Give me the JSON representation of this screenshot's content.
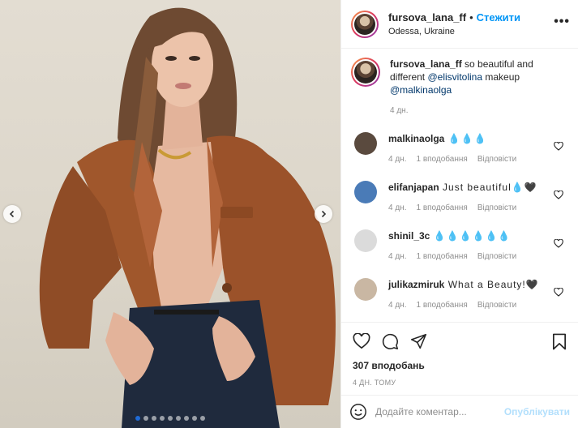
{
  "post": {
    "author": "fursova_lana_ff",
    "follow_label": "Стежити",
    "location": "Odessa, Ukraine",
    "more_label": "•••"
  },
  "caption": {
    "author": "fursova_lana_ff",
    "text_part1": " so beautiful and different ",
    "mention1": "@elisvitolina",
    "text_part2": " makeup ",
    "mention2": "@malkinaolga",
    "age": "4 дн."
  },
  "comments": [
    {
      "user": "malkinaolga",
      "text": " 💧💧💧",
      "age": "4 дн.",
      "likes": "1 вподобання",
      "reply": "Відповісти",
      "avatar_color": "#5a4a3e"
    },
    {
      "user": "elifanjapan",
      "text": " Just beautiful💧🖤",
      "age": "4 дн.",
      "likes": "1 вподобання",
      "reply": "Відповісти",
      "avatar_color": "#4a7bb7"
    },
    {
      "user": "shinil_3c",
      "text": " 💧💧💧💧💧💧",
      "age": "4 дн.",
      "likes": "1 вподобання",
      "reply": "Відповісти",
      "avatar_color": "#dbdbdb"
    },
    {
      "user": "julikazmiruk",
      "text": " What a Beauty!🖤",
      "age": "4 дн.",
      "likes": "1 вподобання",
      "reply": "Відповісти",
      "avatar_color": "#c9b7a3"
    }
  ],
  "stats": {
    "likes": "307 вподобань",
    "time": "4 ДН. ТОМУ"
  },
  "add_comment": {
    "placeholder": "Додайте коментар...",
    "publish_label": "Опублікувати"
  },
  "carousel": {
    "slide_count": 9,
    "active_index": 0
  },
  "colors": {
    "accent": "#0095f6",
    "jacket": "#a0572c",
    "background": "#ddd7cb"
  }
}
